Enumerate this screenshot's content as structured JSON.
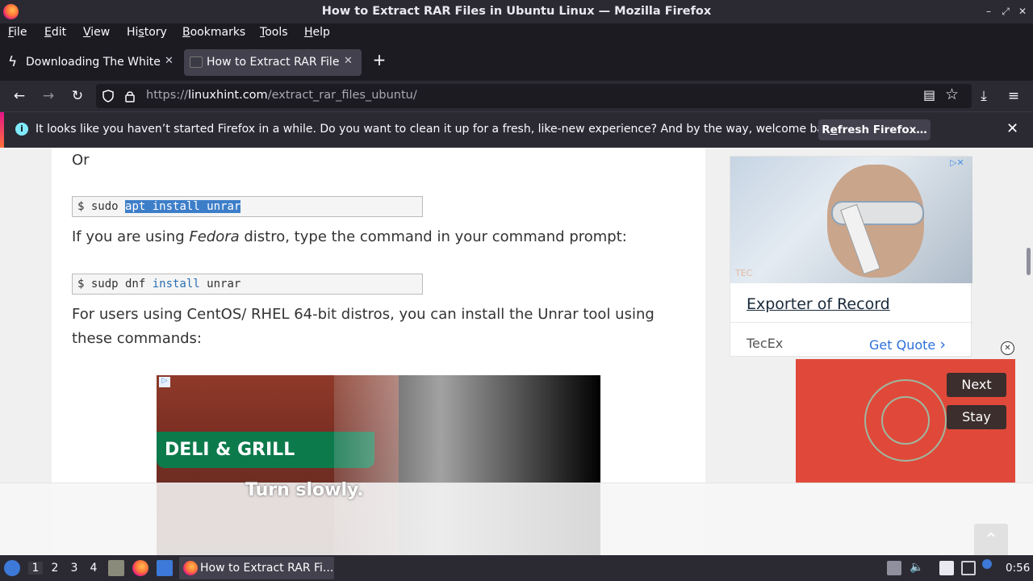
{
  "window": {
    "title": "How to Extract RAR Files in Ubuntu Linux — Mozilla Firefox",
    "minimize_glyph": "–",
    "maximize_glyph": "⤢",
    "close_glyph": "✕"
  },
  "menubar": {
    "items": [
      {
        "pre": "",
        "u": "F",
        "post": "ile"
      },
      {
        "pre": "",
        "u": "E",
        "post": "dit"
      },
      {
        "pre": "",
        "u": "V",
        "post": "iew"
      },
      {
        "pre": "Hi",
        "u": "s",
        "post": "tory"
      },
      {
        "pre": "",
        "u": "B",
        "post": "ookmarks"
      },
      {
        "pre": "",
        "u": "T",
        "post": "ools"
      },
      {
        "pre": "",
        "u": "H",
        "post": "elp"
      }
    ]
  },
  "tabs": [
    {
      "label": "Downloading The White H",
      "icon": "bolt-icon",
      "close": "✕"
    },
    {
      "label": "How to Extract RAR Files",
      "icon": "site-favicon",
      "close": "✕"
    }
  ],
  "newtab": "+",
  "nav": {
    "back": "←",
    "forward": "→",
    "reload": "↻",
    "url_prefix": "https://",
    "url_host": "linuxhint.com",
    "url_path": "/extract_rar_files_ubuntu/",
    "reader": "▤",
    "bookmark": "☆",
    "download": "⤓",
    "menu": "≡"
  },
  "infobar": {
    "icon": "i",
    "message": "It looks like you haven’t started Firefox in a while. Do you want to clean it up for a fresh, like-new experience? And by the way, welcome back!",
    "button_pre": "R",
    "button_u": "e",
    "button_post": "fresh Firefox…",
    "close": "✕"
  },
  "article": {
    "or": "Or",
    "code1": {
      "prompt": "$ sudo ",
      "selected": "apt install unrar"
    },
    "fedora_pre": "If you are using ",
    "fedora_em": "Fedora",
    "fedora_post": " distro, type the command in your command prompt:",
    "code2": {
      "prompt": "$ sudp dnf ",
      "keyword": "install",
      "rest": " unrar"
    },
    "centos": "For users using CentOS/ RHEL 64-bit distros, you can install the Unrar tool using these commands:",
    "video_sign": "DELI & GRILL",
    "video_subtitle": "Turn slowly."
  },
  "ads": {
    "card": {
      "watermark": "TEC",
      "adchoices": "▷✕",
      "headline": "Exporter of Record",
      "advertiser": "TecEx",
      "cta": "Get Quote",
      "cta_arrow": "›"
    },
    "close": "✕",
    "video": {
      "next": "Next",
      "stay": "Stay"
    },
    "badge": "▷"
  },
  "scroll_top": "⌃",
  "taskbar": {
    "workspaces": [
      "1",
      "2",
      "3",
      "4"
    ],
    "task_label": "How to Extract RAR Fi...",
    "clock": "0:56",
    "tray_icons": [
      "usb-icon",
      "volume-icon",
      "clipboard-icon",
      "display-icon",
      "notification-icon"
    ]
  },
  "colors": {
    "accent": "#3d7ec9",
    "ad_red": "#e0493a",
    "link_blue": "#2d6fd8"
  }
}
